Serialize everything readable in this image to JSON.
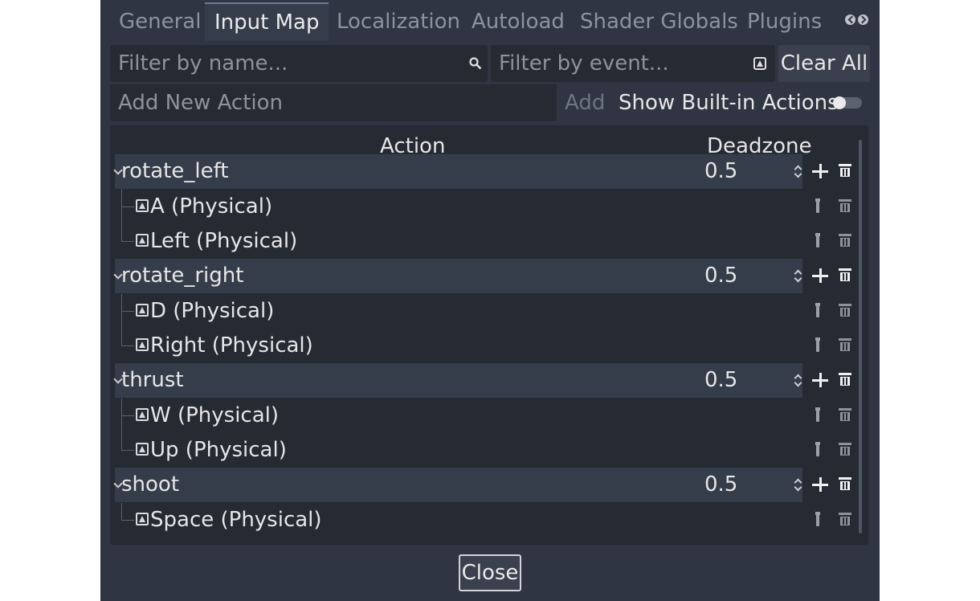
{
  "tabs": [
    {
      "label": "General"
    },
    {
      "label": "Input Map"
    },
    {
      "label": "Localization"
    },
    {
      "label": "Autoload"
    },
    {
      "label": "Shader Globals"
    },
    {
      "label": "Plugins"
    }
  ],
  "active_tab": "Input Map",
  "filters": {
    "name_placeholder": "Filter by name...",
    "event_placeholder": "Filter by event...",
    "clear_all_label": "Clear All"
  },
  "add_action": {
    "placeholder": "Add New Action",
    "add_label": "Add",
    "show_builtin_label": "Show Built-in Actions",
    "show_builtin_enabled": false
  },
  "tree": {
    "header_action": "Action",
    "header_deadzone": "Deadzone",
    "actions": [
      {
        "name": "rotate_left",
        "deadzone": "0.5",
        "events": [
          "A (Physical)",
          "Left (Physical)"
        ]
      },
      {
        "name": "rotate_right",
        "deadzone": "0.5",
        "events": [
          "D (Physical)",
          "Right (Physical)"
        ]
      },
      {
        "name": "thrust",
        "deadzone": "0.5",
        "events": [
          "W (Physical)",
          "Up (Physical)"
        ]
      },
      {
        "name": "shoot",
        "deadzone": "0.5",
        "events": [
          "Space (Physical)"
        ]
      }
    ]
  },
  "close_label": "Close",
  "colors": {
    "panel_bg": "#2f3542",
    "tree_bg": "#252a33",
    "action_row_bg": "#363d4a",
    "text": "#e6e6e6",
    "muted_text": "#8b93a0"
  }
}
